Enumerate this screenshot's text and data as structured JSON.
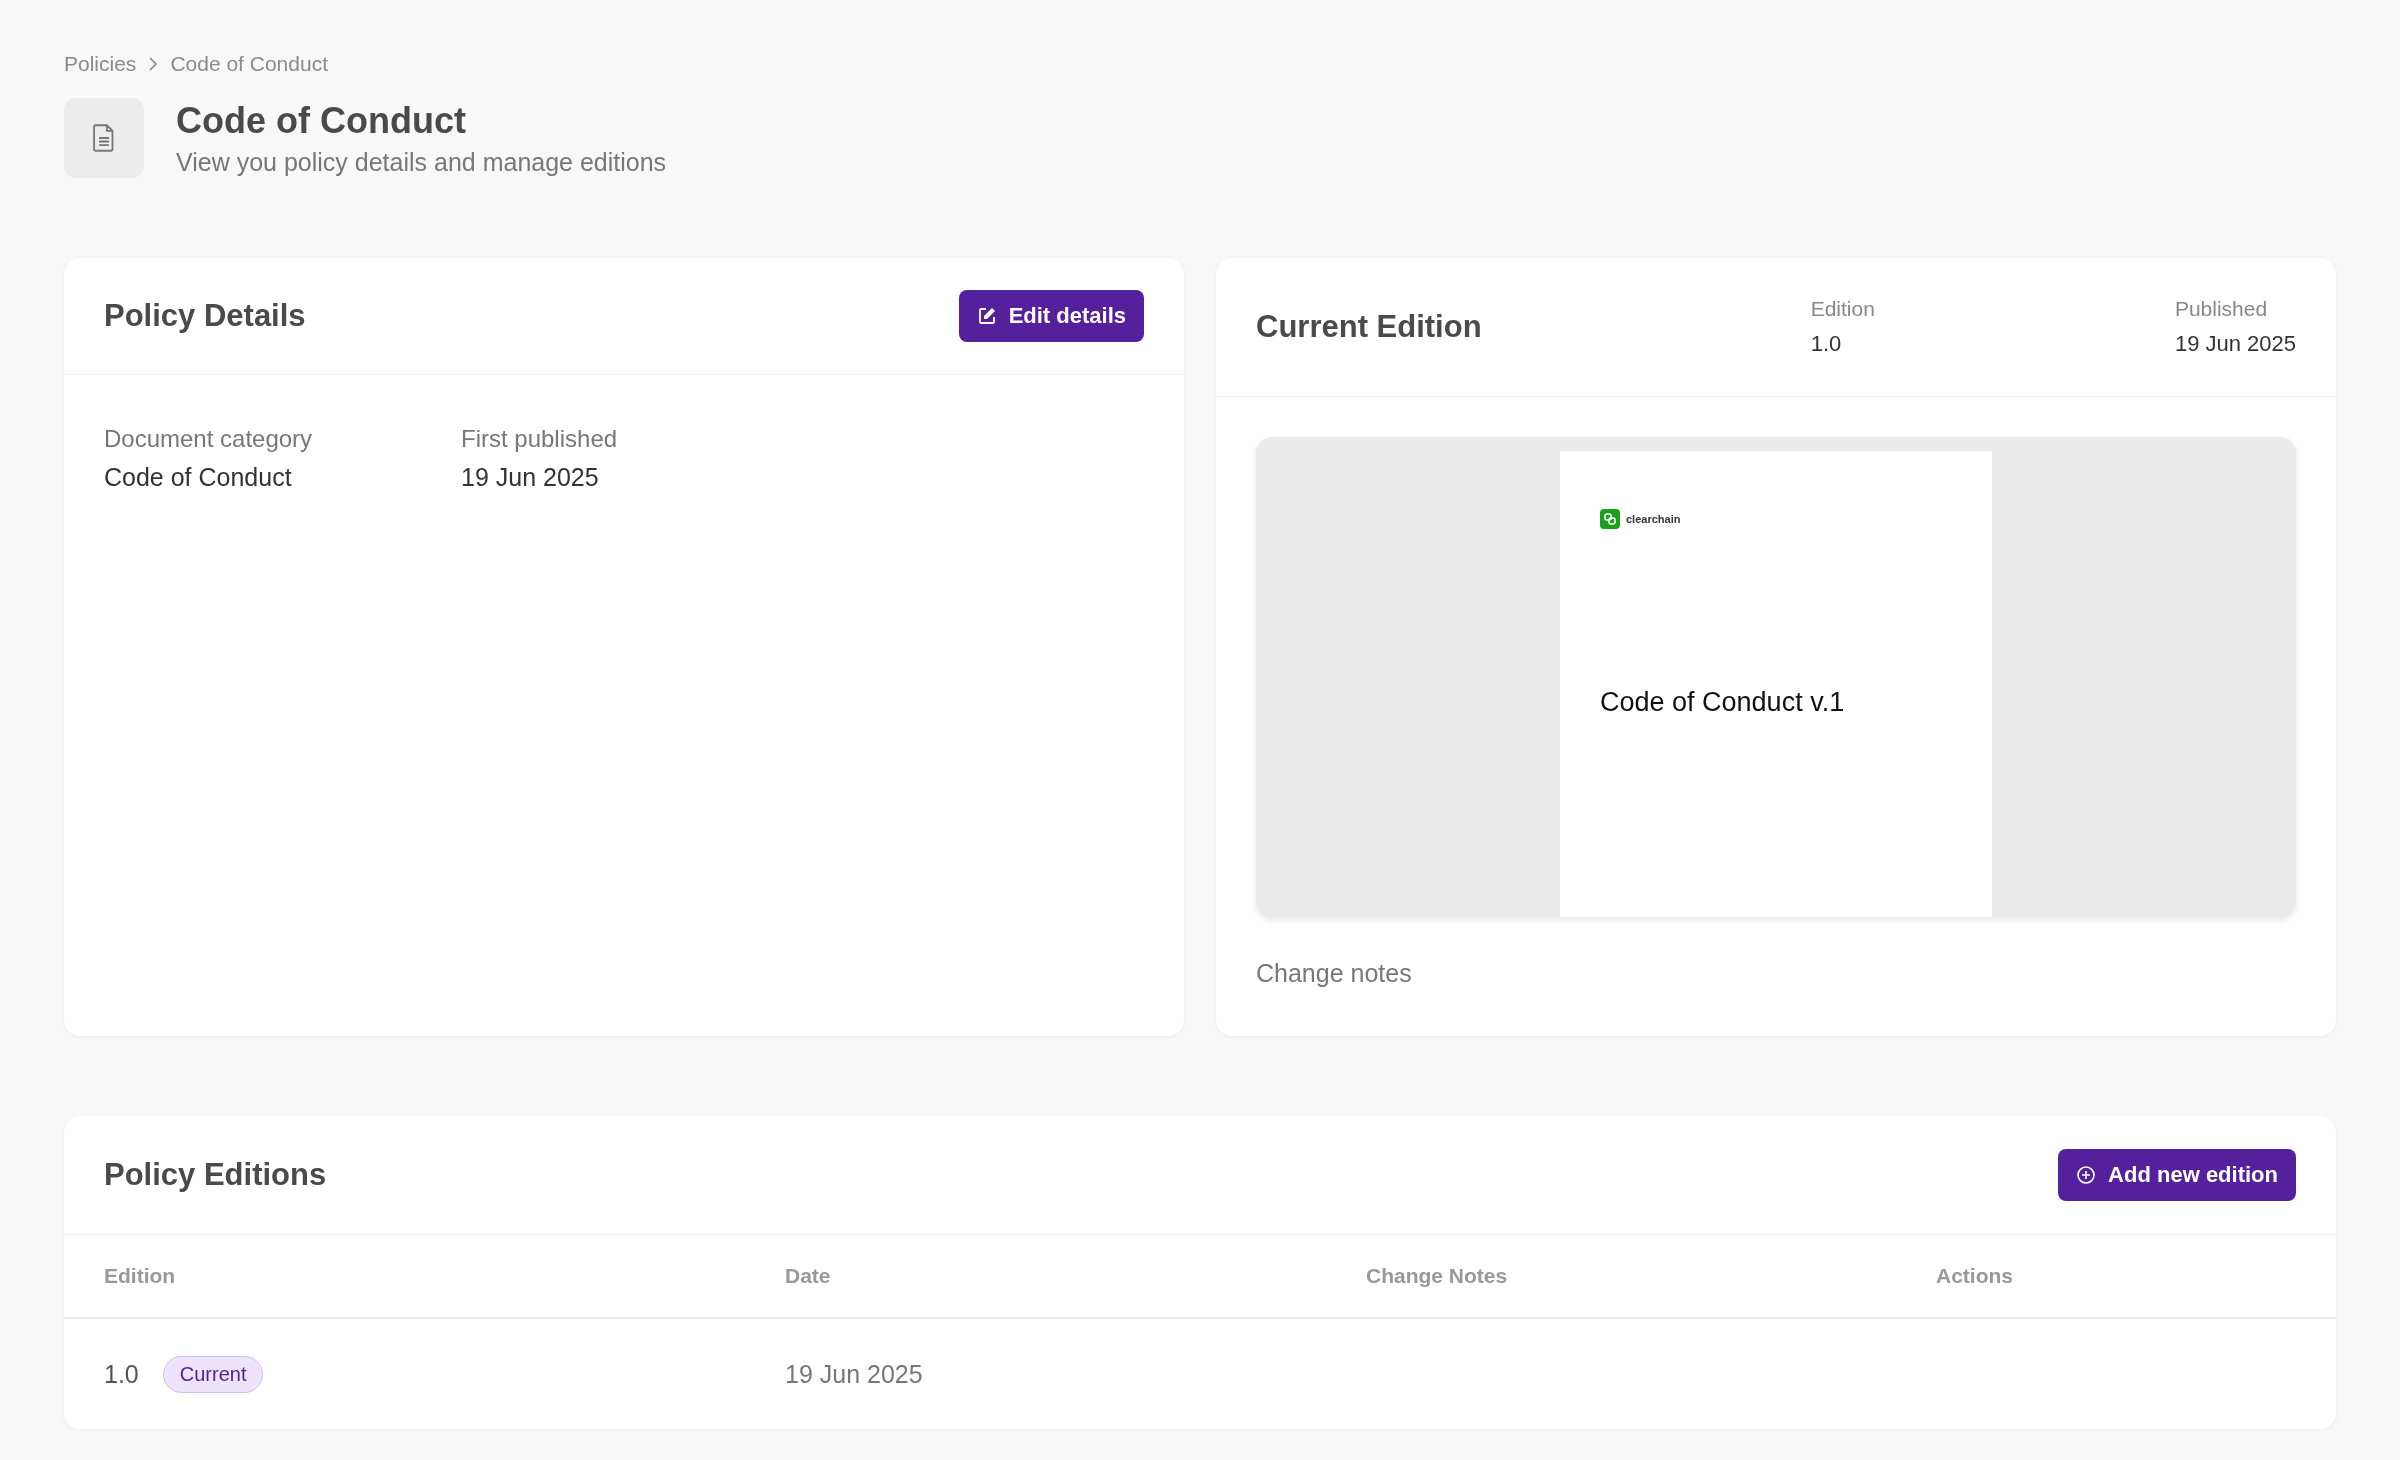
{
  "breadcrumb": [
    "Policies",
    "Code of Conduct"
  ],
  "header": {
    "title": "Code of Conduct",
    "subtitle": "View you policy details and manage editions"
  },
  "policy_details": {
    "title": "Policy Details",
    "button": "Edit details",
    "fields": [
      {
        "label": "Document category",
        "value": "Code of Conduct"
      },
      {
        "label": "First published",
        "value": "19 Jun 2025"
      }
    ]
  },
  "current_edition": {
    "title": "Current Edition",
    "meta": [
      {
        "label": "Edition",
        "value": "1.0"
      },
      {
        "label": "Published",
        "value": "19 Jun 2025"
      }
    ],
    "preview": {
      "logo": "clearchain",
      "heading": "Code of Conduct v.1"
    },
    "change_notes_label": "Change notes"
  },
  "policy_editions": {
    "title": "Policy Editions",
    "button": "Add new edition",
    "columns": [
      "Edition",
      "Date",
      "Change Notes",
      "Actions"
    ],
    "rows": [
      {
        "edition": "1.0",
        "badge": "Current",
        "date": "19 Jun 2025"
      }
    ]
  }
}
